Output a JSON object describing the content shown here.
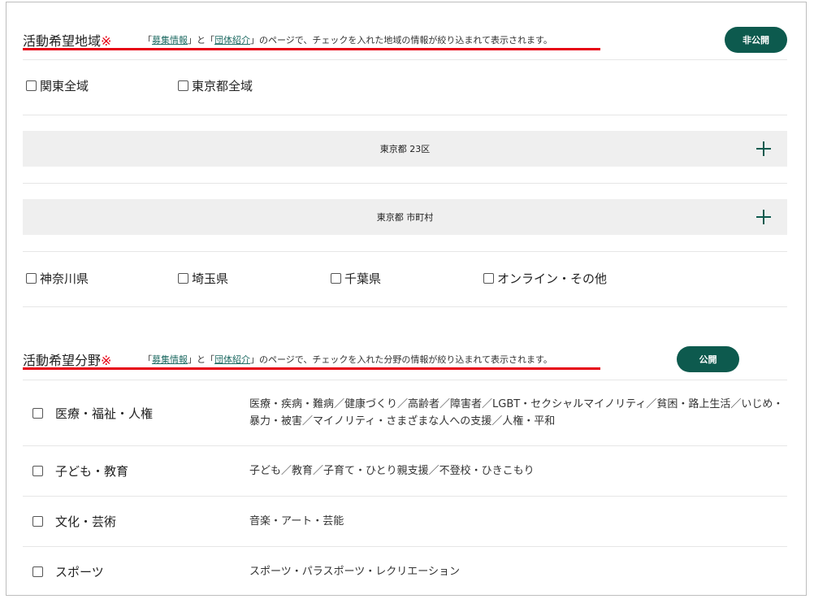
{
  "region": {
    "title": "活動希望地域",
    "required_mark": "※",
    "note_open": "「",
    "note_link1": "募集情報",
    "note_mid": "」と「",
    "note_link2": "団体紹介",
    "note_rest": "」のページで、チェックを入れた地域の情報が絞り込まれて表示されます。",
    "visibility_label": "非公開",
    "row1": [
      "関東全域",
      "東京都全域"
    ],
    "accordions": [
      "東京都 23区",
      "東京都 市町村"
    ],
    "row2": [
      "神奈川県",
      "埼玉県",
      "千葉県",
      "オンライン・その他"
    ]
  },
  "field": {
    "title": "活動希望分野",
    "required_mark": "※",
    "note_open": "「",
    "note_link1": "募集情報",
    "note_mid": "」と「",
    "note_link2": "団体紹介",
    "note_rest": "」のページで、チェックを入れた分野の情報が絞り込まれて表示されます。",
    "visibility_label": "公開",
    "rows": [
      {
        "name": "医療・福祉・人権",
        "desc": "医療・疾病・難病／健康づくり／高齢者／障害者／LGBT・セクシャルマイノリティ／貧困・路上生活／いじめ・暴力・被害／マイノリティ・さまざまな人への支援／人権・平和"
      },
      {
        "name": "子ども・教育",
        "desc": "子ども／教育／子育て・ひとり親支援／不登校・ひきこもり"
      },
      {
        "name": "文化・芸術",
        "desc": "音楽・アート・芸能"
      },
      {
        "name": "スポーツ",
        "desc": "スポーツ・パラスポーツ・レクリエーション"
      }
    ]
  },
  "colors": {
    "accent_green": "#0d5a4e",
    "required_red": "#e60012",
    "link_green": "#1f6b63"
  },
  "icons": {
    "accordion_expand": "plus-icon"
  }
}
